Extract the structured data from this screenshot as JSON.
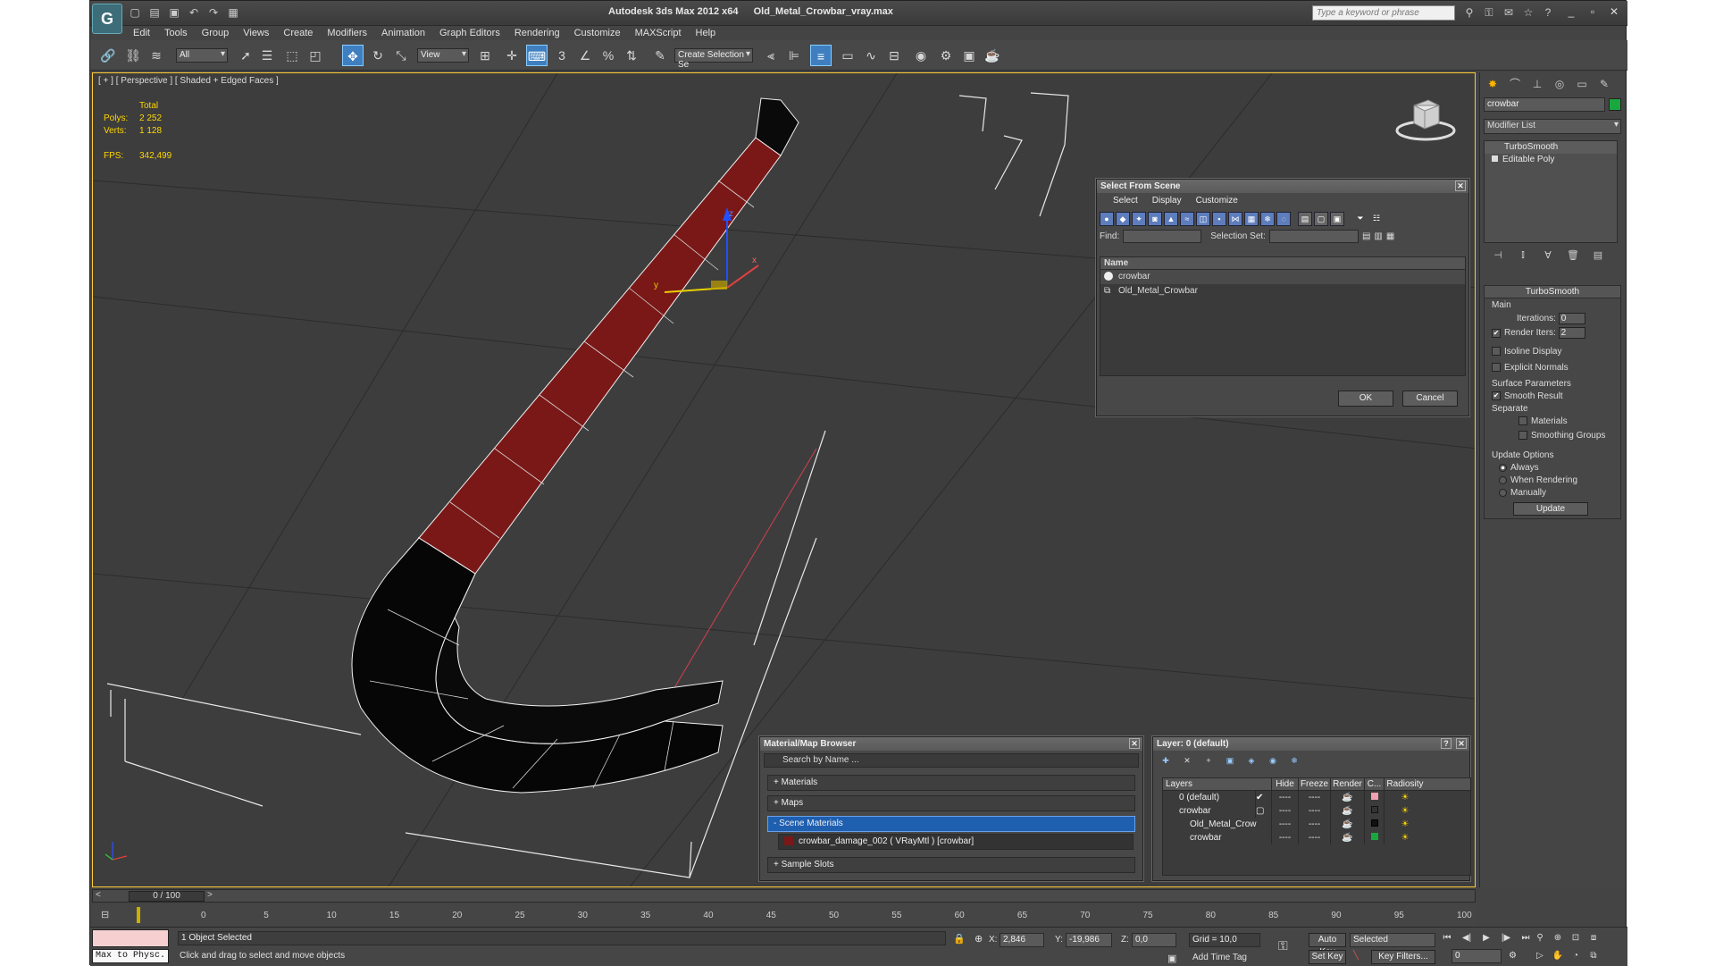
{
  "window": {
    "app_title": "Autodesk 3ds Max  2012 x64",
    "file_title": "Old_Metal_Crowbar_vray.max",
    "search_placeholder": "Type a keyword or phrase"
  },
  "menu": [
    "Edit",
    "Tools",
    "Group",
    "Views",
    "Create",
    "Modifiers",
    "Animation",
    "Graph Editors",
    "Rendering",
    "Customize",
    "MAXScript",
    "Help"
  ],
  "toolbar": {
    "filter_value": "All",
    "coord_value": "View",
    "selection_set_placeholder": "Create Selection Se"
  },
  "viewport": {
    "label": "[ + ] [ Perspective ] [ Shaded + Edged Faces ]",
    "stats": {
      "total_label": "Total",
      "polys_label": "Polys:",
      "polys_value": "2 252",
      "verts_label": "Verts:",
      "verts_value": "1 128",
      "fps_label": "FPS:",
      "fps_value": "342,499"
    },
    "gizmo": {
      "x": "x",
      "y": "y",
      "z": "z"
    }
  },
  "command_panel": {
    "object_name": "crowbar",
    "object_color": "#19a840",
    "modifier_list": "Modifier List",
    "stack": [
      "TurboSmooth",
      "Editable Poly"
    ],
    "turbosmooth": {
      "title": "TurboSmooth",
      "main_label": "Main",
      "iterations_label": "Iterations:",
      "iterations_value": "0",
      "render_iters_label": "Render Iters:",
      "render_iters_value": "2",
      "isoline_label": "Isoline Display",
      "explicit_normals_label": "Explicit Normals",
      "surface_params_label": "Surface Parameters",
      "smooth_result_label": "Smooth Result",
      "separate_label": "Separate",
      "materials_label": "Materials",
      "smoothing_groups_label": "Smoothing Groups",
      "update_options_label": "Update Options",
      "always_label": "Always",
      "when_rendering_label": "When Rendering",
      "manually_label": "Manually",
      "update_button": "Update"
    }
  },
  "select_from_scene": {
    "title": "Select From Scene",
    "menu": [
      "Select",
      "Display",
      "Customize"
    ],
    "find_label": "Find:",
    "selection_set_label": "Selection Set:",
    "column_name": "Name",
    "items": [
      "crowbar",
      "Old_Metal_Crowbar"
    ],
    "ok": "OK",
    "cancel": "Cancel"
  },
  "material_browser": {
    "title": "Material/Map Browser",
    "search_placeholder": "Search by Name ...",
    "sections": {
      "materials": "+ Materials",
      "maps": "+ Maps",
      "scene_materials": "- Scene Materials",
      "scene_material_item": "crowbar_damage_002  ( VRayMtl )  [crowbar]",
      "sample_slots": "+ Sample Slots"
    }
  },
  "layer_dialog": {
    "title": "Layer: 0 (default)",
    "columns": [
      "Layers",
      "Hide",
      "Freeze",
      "Render",
      "C...",
      "Radiosity"
    ],
    "rows": [
      {
        "name": "0 (default)",
        "hide": "----",
        "freeze": "----",
        "color": "#f0a0b0"
      },
      {
        "name": "crowbar",
        "hide": "----",
        "freeze": "----",
        "color": "#333333"
      },
      {
        "name": "Old_Metal_Crow",
        "hide": "----",
        "freeze": "----",
        "color": "#111111"
      },
      {
        "name": "crowbar",
        "hide": "----",
        "freeze": "----",
        "color": "#19a840"
      }
    ]
  },
  "timeline": {
    "slider_label": "0 / 100",
    "ticks": [
      "0",
      "5",
      "10",
      "15",
      "20",
      "25",
      "30",
      "35",
      "40",
      "45",
      "50",
      "55",
      "60",
      "65",
      "70",
      "75",
      "80",
      "85",
      "90",
      "95",
      "100"
    ]
  },
  "status": {
    "maxscript_label": "Max to Physc.",
    "selection_info": "1 Object Selected",
    "prompt": "Click and drag to select and move objects",
    "x_label": "X:",
    "x_value": "2,846",
    "y_label": "Y:",
    "y_value": "-19,986",
    "z_label": "Z:",
    "z_value": "0,0",
    "grid": "Grid = 10,0",
    "add_time_tag": "Add Time Tag",
    "auto_key": "Auto Key",
    "set_key": "Set Key",
    "key_mode_value": "Selected",
    "key_filters": "Key Filters...",
    "frame_value": "0"
  }
}
